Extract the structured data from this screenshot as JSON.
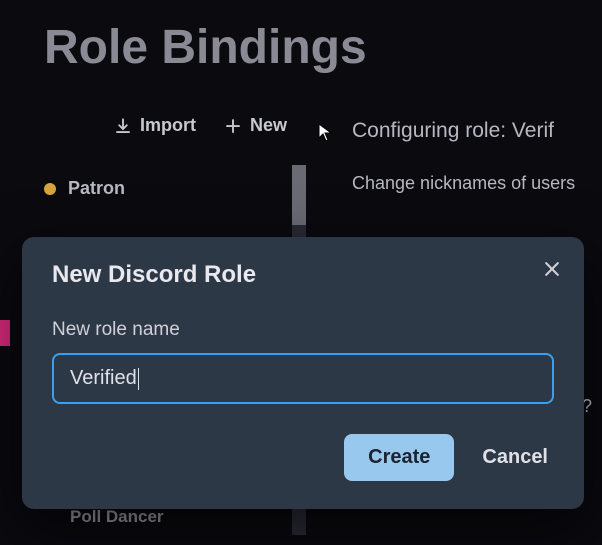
{
  "page": {
    "title": "Role Bindings"
  },
  "toolbar": {
    "import_label": "Import",
    "new_label": "New"
  },
  "roles": {
    "items": [
      {
        "label": "Patron",
        "color": "#d6a63a"
      }
    ],
    "poll_dancer": "Poll Dancer"
  },
  "config": {
    "title_prefix": "Configuring role: Verif",
    "desc": "Change nicknames of users "
  },
  "modal": {
    "title": "New Discord Role",
    "label": "New role name",
    "input_value": "Verified",
    "create_label": "Create",
    "cancel_label": "Cancel"
  },
  "stray": {
    "q": "?"
  }
}
